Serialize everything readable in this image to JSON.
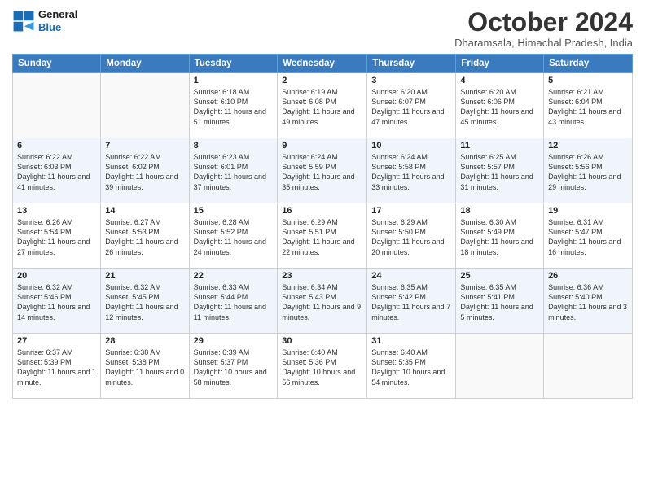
{
  "logo": {
    "line1": "General",
    "line2": "Blue"
  },
  "title": "October 2024",
  "subtitle": "Dharamsala, Himachal Pradesh, India",
  "days_of_week": [
    "Sunday",
    "Monday",
    "Tuesday",
    "Wednesday",
    "Thursday",
    "Friday",
    "Saturday"
  ],
  "weeks": [
    [
      {
        "day": "",
        "info": ""
      },
      {
        "day": "",
        "info": ""
      },
      {
        "day": "1",
        "info": "Sunrise: 6:18 AM\nSunset: 6:10 PM\nDaylight: 11 hours and 51 minutes."
      },
      {
        "day": "2",
        "info": "Sunrise: 6:19 AM\nSunset: 6:08 PM\nDaylight: 11 hours and 49 minutes."
      },
      {
        "day": "3",
        "info": "Sunrise: 6:20 AM\nSunset: 6:07 PM\nDaylight: 11 hours and 47 minutes."
      },
      {
        "day": "4",
        "info": "Sunrise: 6:20 AM\nSunset: 6:06 PM\nDaylight: 11 hours and 45 minutes."
      },
      {
        "day": "5",
        "info": "Sunrise: 6:21 AM\nSunset: 6:04 PM\nDaylight: 11 hours and 43 minutes."
      }
    ],
    [
      {
        "day": "6",
        "info": "Sunrise: 6:22 AM\nSunset: 6:03 PM\nDaylight: 11 hours and 41 minutes."
      },
      {
        "day": "7",
        "info": "Sunrise: 6:22 AM\nSunset: 6:02 PM\nDaylight: 11 hours and 39 minutes."
      },
      {
        "day": "8",
        "info": "Sunrise: 6:23 AM\nSunset: 6:01 PM\nDaylight: 11 hours and 37 minutes."
      },
      {
        "day": "9",
        "info": "Sunrise: 6:24 AM\nSunset: 5:59 PM\nDaylight: 11 hours and 35 minutes."
      },
      {
        "day": "10",
        "info": "Sunrise: 6:24 AM\nSunset: 5:58 PM\nDaylight: 11 hours and 33 minutes."
      },
      {
        "day": "11",
        "info": "Sunrise: 6:25 AM\nSunset: 5:57 PM\nDaylight: 11 hours and 31 minutes."
      },
      {
        "day": "12",
        "info": "Sunrise: 6:26 AM\nSunset: 5:56 PM\nDaylight: 11 hours and 29 minutes."
      }
    ],
    [
      {
        "day": "13",
        "info": "Sunrise: 6:26 AM\nSunset: 5:54 PM\nDaylight: 11 hours and 27 minutes."
      },
      {
        "day": "14",
        "info": "Sunrise: 6:27 AM\nSunset: 5:53 PM\nDaylight: 11 hours and 26 minutes."
      },
      {
        "day": "15",
        "info": "Sunrise: 6:28 AM\nSunset: 5:52 PM\nDaylight: 11 hours and 24 minutes."
      },
      {
        "day": "16",
        "info": "Sunrise: 6:29 AM\nSunset: 5:51 PM\nDaylight: 11 hours and 22 minutes."
      },
      {
        "day": "17",
        "info": "Sunrise: 6:29 AM\nSunset: 5:50 PM\nDaylight: 11 hours and 20 minutes."
      },
      {
        "day": "18",
        "info": "Sunrise: 6:30 AM\nSunset: 5:49 PM\nDaylight: 11 hours and 18 minutes."
      },
      {
        "day": "19",
        "info": "Sunrise: 6:31 AM\nSunset: 5:47 PM\nDaylight: 11 hours and 16 minutes."
      }
    ],
    [
      {
        "day": "20",
        "info": "Sunrise: 6:32 AM\nSunset: 5:46 PM\nDaylight: 11 hours and 14 minutes."
      },
      {
        "day": "21",
        "info": "Sunrise: 6:32 AM\nSunset: 5:45 PM\nDaylight: 11 hours and 12 minutes."
      },
      {
        "day": "22",
        "info": "Sunrise: 6:33 AM\nSunset: 5:44 PM\nDaylight: 11 hours and 11 minutes."
      },
      {
        "day": "23",
        "info": "Sunrise: 6:34 AM\nSunset: 5:43 PM\nDaylight: 11 hours and 9 minutes."
      },
      {
        "day": "24",
        "info": "Sunrise: 6:35 AM\nSunset: 5:42 PM\nDaylight: 11 hours and 7 minutes."
      },
      {
        "day": "25",
        "info": "Sunrise: 6:35 AM\nSunset: 5:41 PM\nDaylight: 11 hours and 5 minutes."
      },
      {
        "day": "26",
        "info": "Sunrise: 6:36 AM\nSunset: 5:40 PM\nDaylight: 11 hours and 3 minutes."
      }
    ],
    [
      {
        "day": "27",
        "info": "Sunrise: 6:37 AM\nSunset: 5:39 PM\nDaylight: 11 hours and 1 minute."
      },
      {
        "day": "28",
        "info": "Sunrise: 6:38 AM\nSunset: 5:38 PM\nDaylight: 11 hours and 0 minutes."
      },
      {
        "day": "29",
        "info": "Sunrise: 6:39 AM\nSunset: 5:37 PM\nDaylight: 10 hours and 58 minutes."
      },
      {
        "day": "30",
        "info": "Sunrise: 6:40 AM\nSunset: 5:36 PM\nDaylight: 10 hours and 56 minutes."
      },
      {
        "day": "31",
        "info": "Sunrise: 6:40 AM\nSunset: 5:35 PM\nDaylight: 10 hours and 54 minutes."
      },
      {
        "day": "",
        "info": ""
      },
      {
        "day": "",
        "info": ""
      }
    ]
  ]
}
